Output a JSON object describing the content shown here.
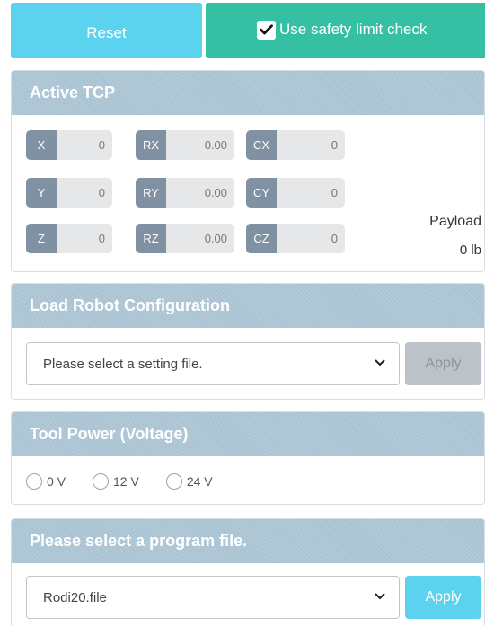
{
  "toolbar": {
    "reset_label": "Reset",
    "safety_label": "Use safety limit check",
    "safety_checked": true
  },
  "active_tcp": {
    "title": "Active TCP",
    "fields": [
      {
        "tag": "X",
        "value": "0"
      },
      {
        "tag": "RX",
        "value": "0.00"
      },
      {
        "tag": "CX",
        "value": "0"
      },
      {
        "tag": "Y",
        "value": "0"
      },
      {
        "tag": "RY",
        "value": "0.00"
      },
      {
        "tag": "CY",
        "value": "0"
      },
      {
        "tag": "Z",
        "value": "0"
      },
      {
        "tag": "RZ",
        "value": "0.00"
      },
      {
        "tag": "CZ",
        "value": "0"
      }
    ],
    "payload_label": "Payload",
    "payload_value": "0 lb"
  },
  "load_config": {
    "title": "Load Robot Configuration",
    "select_value": "Please select a setting file.",
    "apply_label": "Apply",
    "apply_enabled": false
  },
  "tool_power": {
    "title": "Tool Power (Voltage)",
    "options": [
      "0 V",
      "12 V",
      "24 V"
    ]
  },
  "program": {
    "title": "Please select a program file.",
    "select_value": "Rodi20.file",
    "apply_label": "Apply",
    "apply_enabled": true
  },
  "colors": {
    "accent_cyan": "#5bd3ee",
    "accent_green": "#36c0a3",
    "header_blue": "#a9c3d3",
    "tag_gray": "#7f91a2"
  },
  "icons": [
    "check-icon",
    "chevron-down-icon"
  ]
}
